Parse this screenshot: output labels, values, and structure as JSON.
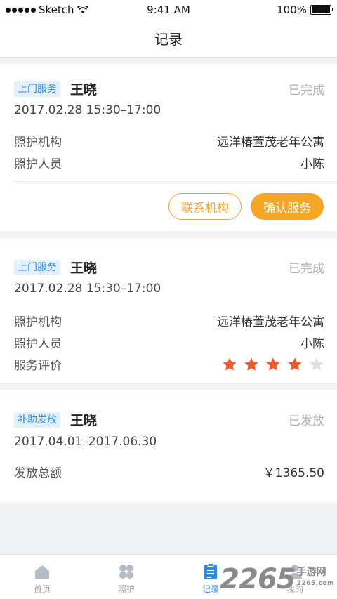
{
  "status_bar": {
    "carrier": "Sketch",
    "time": "9:41 AM",
    "battery": "100%"
  },
  "nav": {
    "title": "记录"
  },
  "records": [
    {
      "tag": "上门服务",
      "name": "王晓",
      "status": "已完成",
      "date": "2017.02.28 15:30–17:00",
      "rows": [
        {
          "label": "照护机构",
          "value": "远洋椿萱茂老年公寓"
        },
        {
          "label": "照护人员",
          "value": "小陈"
        }
      ],
      "buttons": {
        "contact": "联系机构",
        "confirm": "确认服务"
      }
    },
    {
      "tag": "上门服务",
      "name": "王晓",
      "status": "已完成",
      "date": "2017.02.28 15:30–17:00",
      "rows": [
        {
          "label": "照护机构",
          "value": "远洋椿萱茂老年公寓"
        },
        {
          "label": "照护人员",
          "value": "小陈"
        },
        {
          "label": "服务评价"
        }
      ],
      "rating": {
        "score": 4,
        "max": 5
      }
    },
    {
      "tag": "补助发放",
      "name": "王晓",
      "status": "已发放",
      "date": "2017.04.01–2017.06.30",
      "rows": [
        {
          "label": "发放总额",
          "value": "￥1365.50"
        }
      ]
    }
  ],
  "tabs": [
    {
      "label": "首页",
      "icon": "home-icon",
      "active": false
    },
    {
      "label": "照护",
      "icon": "grid-icon",
      "active": false
    },
    {
      "label": "记录",
      "icon": "document-icon",
      "active": true
    },
    {
      "label": "我的",
      "icon": "user-icon",
      "active": false
    }
  ],
  "watermark": {
    "number": "2265",
    "site": "手游网",
    "domain": "2265.com"
  },
  "colors": {
    "accent": "#f5a623",
    "primary": "#2b8ce8",
    "star": "#f0592a",
    "star_empty": "#e0e0e0"
  }
}
